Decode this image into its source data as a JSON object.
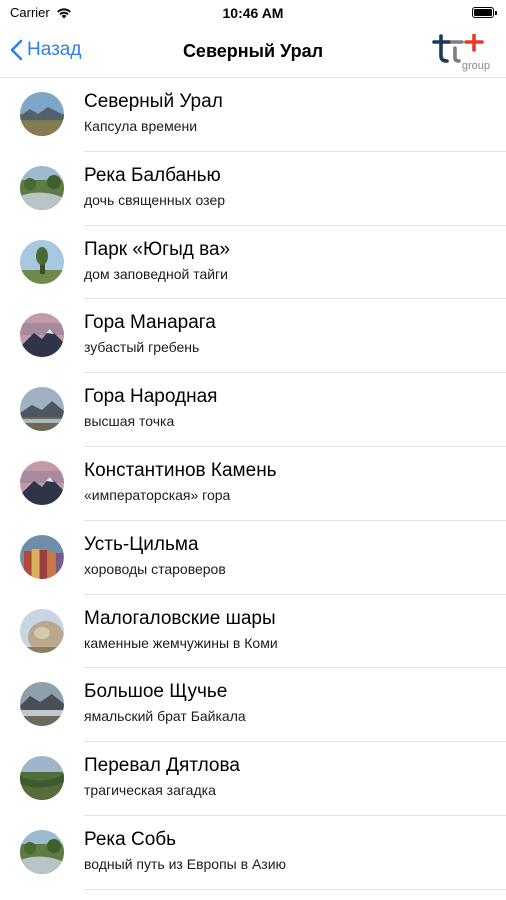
{
  "status_bar": {
    "carrier": "Carrier",
    "time": "10:46 AM",
    "battery_level": 1.0
  },
  "nav": {
    "back_label": "Назад",
    "title": "Северный Урал",
    "logo_text": "group",
    "logo_colors": {
      "t_blue": "#1a3a5c",
      "cross_red": "#e53a2a",
      "cross_gray": "#7a7f86"
    }
  },
  "colors": {
    "accent": "#2f7ef6",
    "divider": "#e3e3e5"
  },
  "items": [
    {
      "title": "Северный Урал",
      "subtitle": "Капсула времени",
      "icon": "landscape-thumbnail"
    },
    {
      "title": "Река Балбанью",
      "subtitle": "дочь священных озер",
      "icon": "river-thumbnail"
    },
    {
      "title": "Парк «Югыд ва»",
      "subtitle": "дом заповедной тайги",
      "icon": "tree-thumbnail"
    },
    {
      "title": "Гора Манарага",
      "subtitle": "зубастый гребень",
      "icon": "mountain-thumbnail"
    },
    {
      "title": "Гора Народная",
      "subtitle": "высшая точка",
      "icon": "mountain-lake-thumbnail"
    },
    {
      "title": "Константинов Камень",
      "subtitle": "«императорская» гора",
      "icon": "mountain-thumbnail"
    },
    {
      "title": "Усть-Цильма",
      "subtitle": "хороводы староверов",
      "icon": "people-thumbnail"
    },
    {
      "title": "Малогаловские шары",
      "subtitle": "каменные жемчужины в Коми",
      "icon": "stone-ball-thumbnail"
    },
    {
      "title": "Большое Щучье",
      "subtitle": "ямальский брат Байкала",
      "icon": "lake-thumbnail"
    },
    {
      "title": "Перевал Дятлова",
      "subtitle": "трагическая загадка",
      "icon": "valley-thumbnail"
    },
    {
      "title": "Река Собь",
      "subtitle": "водный путь из Европы в Азию",
      "icon": "river-thumbnail"
    }
  ]
}
